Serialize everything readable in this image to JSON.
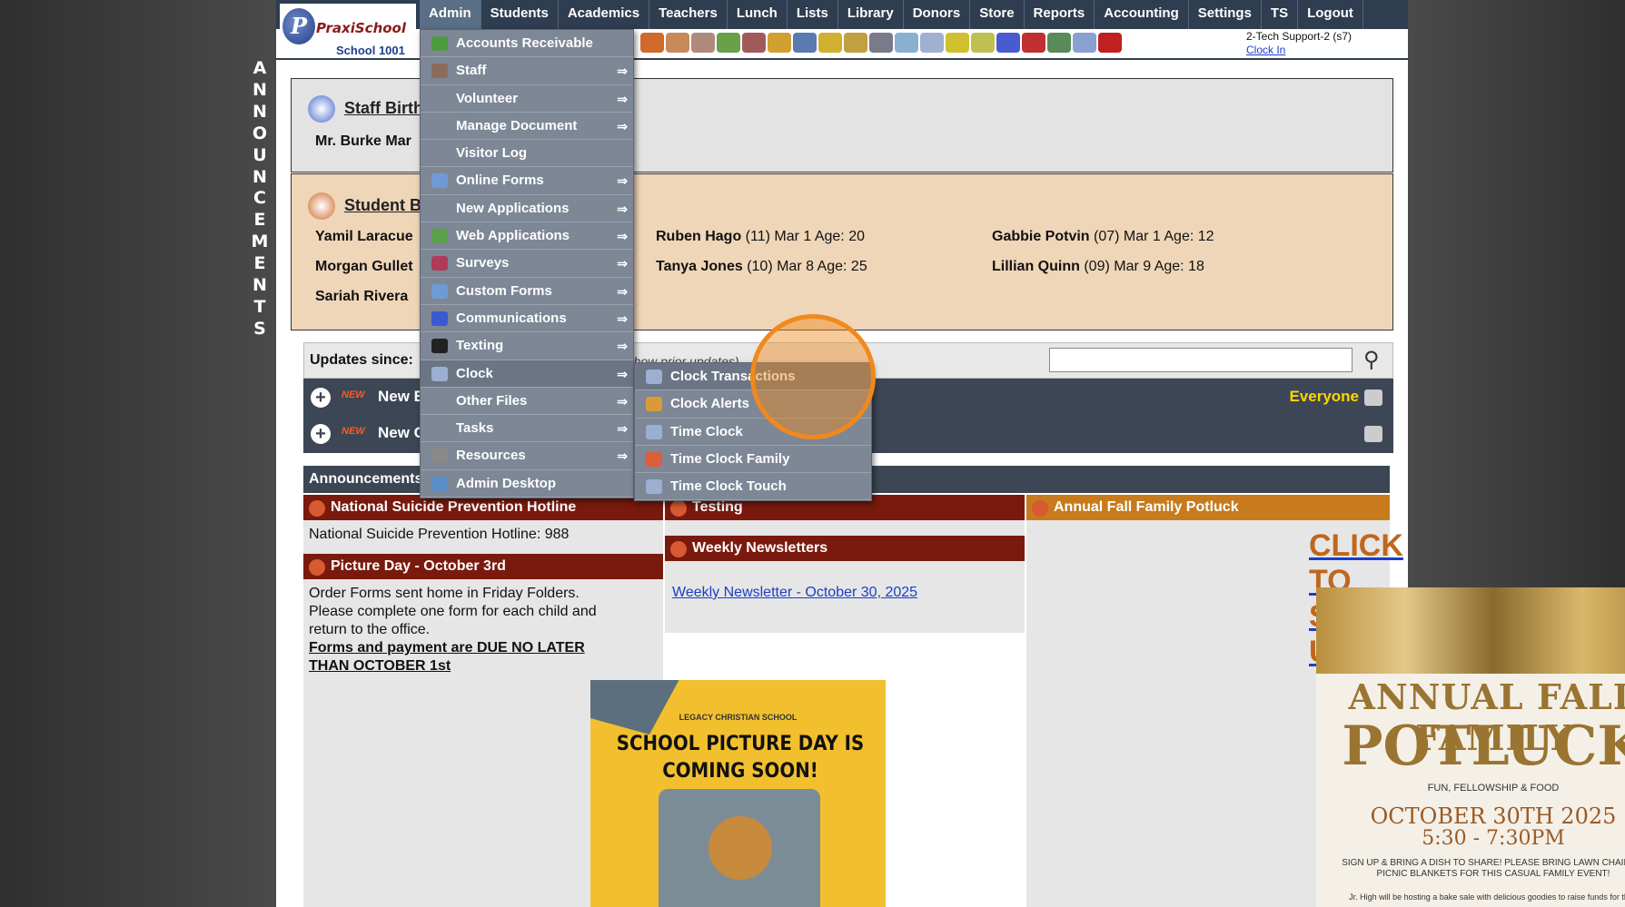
{
  "side_text": [
    "A",
    "N",
    "N",
    "O",
    "U",
    "N",
    "C",
    "E",
    "M",
    "E",
    "N",
    "T",
    "S"
  ],
  "logo": {
    "brand": "PraxiSchool",
    "school": "School 1001"
  },
  "nav": [
    "Admin",
    "Students",
    "Academics",
    "Teachers",
    "Lunch",
    "Lists",
    "Library",
    "Donors",
    "Store",
    "Reports",
    "Accounting",
    "Settings",
    "TS",
    "Logout"
  ],
  "user": {
    "name": "2-Tech Support-2 (s7)",
    "clock_in": "Clock In"
  },
  "staff_birthdays": {
    "title": "Staff Birthdays",
    "entry": "Mr. Burke Mar"
  },
  "student_birthdays": {
    "title": "Student Birthdays",
    "col1": [
      "Yamil Laracue",
      "Morgan Gullet",
      "Sariah Rivera"
    ],
    "col2": [
      {
        "name": "Ruben Hago",
        "rest": " (11) Mar 1 Age: 20"
      },
      {
        "name": "Tanya Jones",
        "rest": " (10) Mar 8 Age: 25"
      }
    ],
    "col3": [
      {
        "name": "Gabbie Potvin",
        "rest": " (07) Mar 1 Age: 12"
      },
      {
        "name": "Lillian Quinn",
        "rest": " (09) Mar 9 Age: 18"
      }
    ]
  },
  "updates": {
    "label": "Updates since:",
    "hint": "to show prior updates)",
    "search_value": ""
  },
  "update_rows": [
    {
      "badge": "NEW",
      "text": "New E",
      "audience": "Everyone"
    },
    {
      "badge": "NEW",
      "text": "New C",
      "audience": ""
    }
  ],
  "announcements_label": "Announcements",
  "columns": {
    "left": [
      {
        "title": "National Suicide Prevention Hotline",
        "body": "National Suicide Prevention Hotline: 988"
      },
      {
        "title": "Picture Day - October 3rd",
        "body": "Order Forms sent home in Friday Folders. Please complete one form for each child and return to the office.",
        "emph": "Forms and payment are DUE NO LATER THAN OCTOBER 1st"
      }
    ],
    "mid": [
      {
        "title": "Testing"
      },
      {
        "title": "Weekly Newsletters",
        "link": "Weekly Newsletter - October 30, 2025"
      }
    ],
    "right": [
      {
        "title": "Annual Fall Family Potluck",
        "cta": "CLICK TO SIGN UP"
      }
    ]
  },
  "poster_picture": {
    "school": "LEGACY CHRISTIAN SCHOOL",
    "headline": "SCHOOL PICTURE DAY IS COMING SOON!"
  },
  "poster_potluck": {
    "line1": "ANNUAL FALL FAMILY",
    "line2": "POTLUCK",
    "tag": "FUN, FELLOWSHIP & FOOD",
    "date": "OCTOBER 30TH 2025",
    "time": "5:30 - 7:30PM",
    "note": "SIGN UP & BRING A DISH TO SHARE! PLEASE BRING LAWN CHAIRS & PICNIC BLANKETS FOR THIS CASUAL FAMILY EVENT!",
    "note2": "Jr. High will be hosting a bake sale with delicious goodies to raise funds for their"
  },
  "admin_menu": [
    {
      "label": "Accounts Receivable",
      "icon": "ar-icon",
      "color": "#4e9a3e",
      "sub": false
    },
    {
      "label": "Staff",
      "icon": "staff-icon",
      "color": "#8b6b5a",
      "sub": true
    },
    {
      "label": "Volunteer",
      "icon": "",
      "color": "",
      "sub": true
    },
    {
      "label": "Manage Document",
      "icon": "",
      "color": "",
      "sub": true
    },
    {
      "label": "Visitor Log",
      "icon": "",
      "color": "",
      "sub": false
    },
    {
      "label": "Online Forms",
      "icon": "html-form-icon",
      "color": "#6f9ad6",
      "sub": true
    },
    {
      "label": "New Applications",
      "icon": "",
      "color": "",
      "sub": true
    },
    {
      "label": "Web Applications",
      "icon": "globe-icon",
      "color": "#5aa04a",
      "sub": true
    },
    {
      "label": "Surveys",
      "icon": "survey-icon",
      "color": "#b03a5a",
      "sub": true
    },
    {
      "label": "Custom Forms",
      "icon": "html-form-icon",
      "color": "#6f9ad6",
      "sub": true
    },
    {
      "label": "Communications",
      "icon": "at-icon",
      "color": "#3a5ad0",
      "sub": true
    },
    {
      "label": "Texting",
      "icon": "phone-icon",
      "color": "#222",
      "sub": true
    },
    {
      "label": "Clock",
      "icon": "clock-icon",
      "color": "#9bb0d0",
      "sub": true,
      "active": true
    },
    {
      "label": "Other Files",
      "icon": "",
      "color": "",
      "sub": true
    },
    {
      "label": "Tasks",
      "icon": "",
      "color": "",
      "sub": true
    },
    {
      "label": "Resources",
      "icon": "resources-icon",
      "color": "#8a8a8a",
      "sub": true
    },
    {
      "label": "Admin Desktop",
      "icon": "desktop-icon",
      "color": "#5c8fc8",
      "sub": false
    }
  ],
  "clock_submenu": [
    {
      "label": "Clock Transactions",
      "color": "#9bb0d0",
      "active": true
    },
    {
      "label": "Clock Alerts",
      "color": "#d99a3a"
    },
    {
      "label": "Time Clock",
      "color": "#9bb0d0"
    },
    {
      "label": "Time Clock Family",
      "color": "#d9603a"
    },
    {
      "label": "Time Clock Touch",
      "color": "#9bb0d0"
    }
  ]
}
